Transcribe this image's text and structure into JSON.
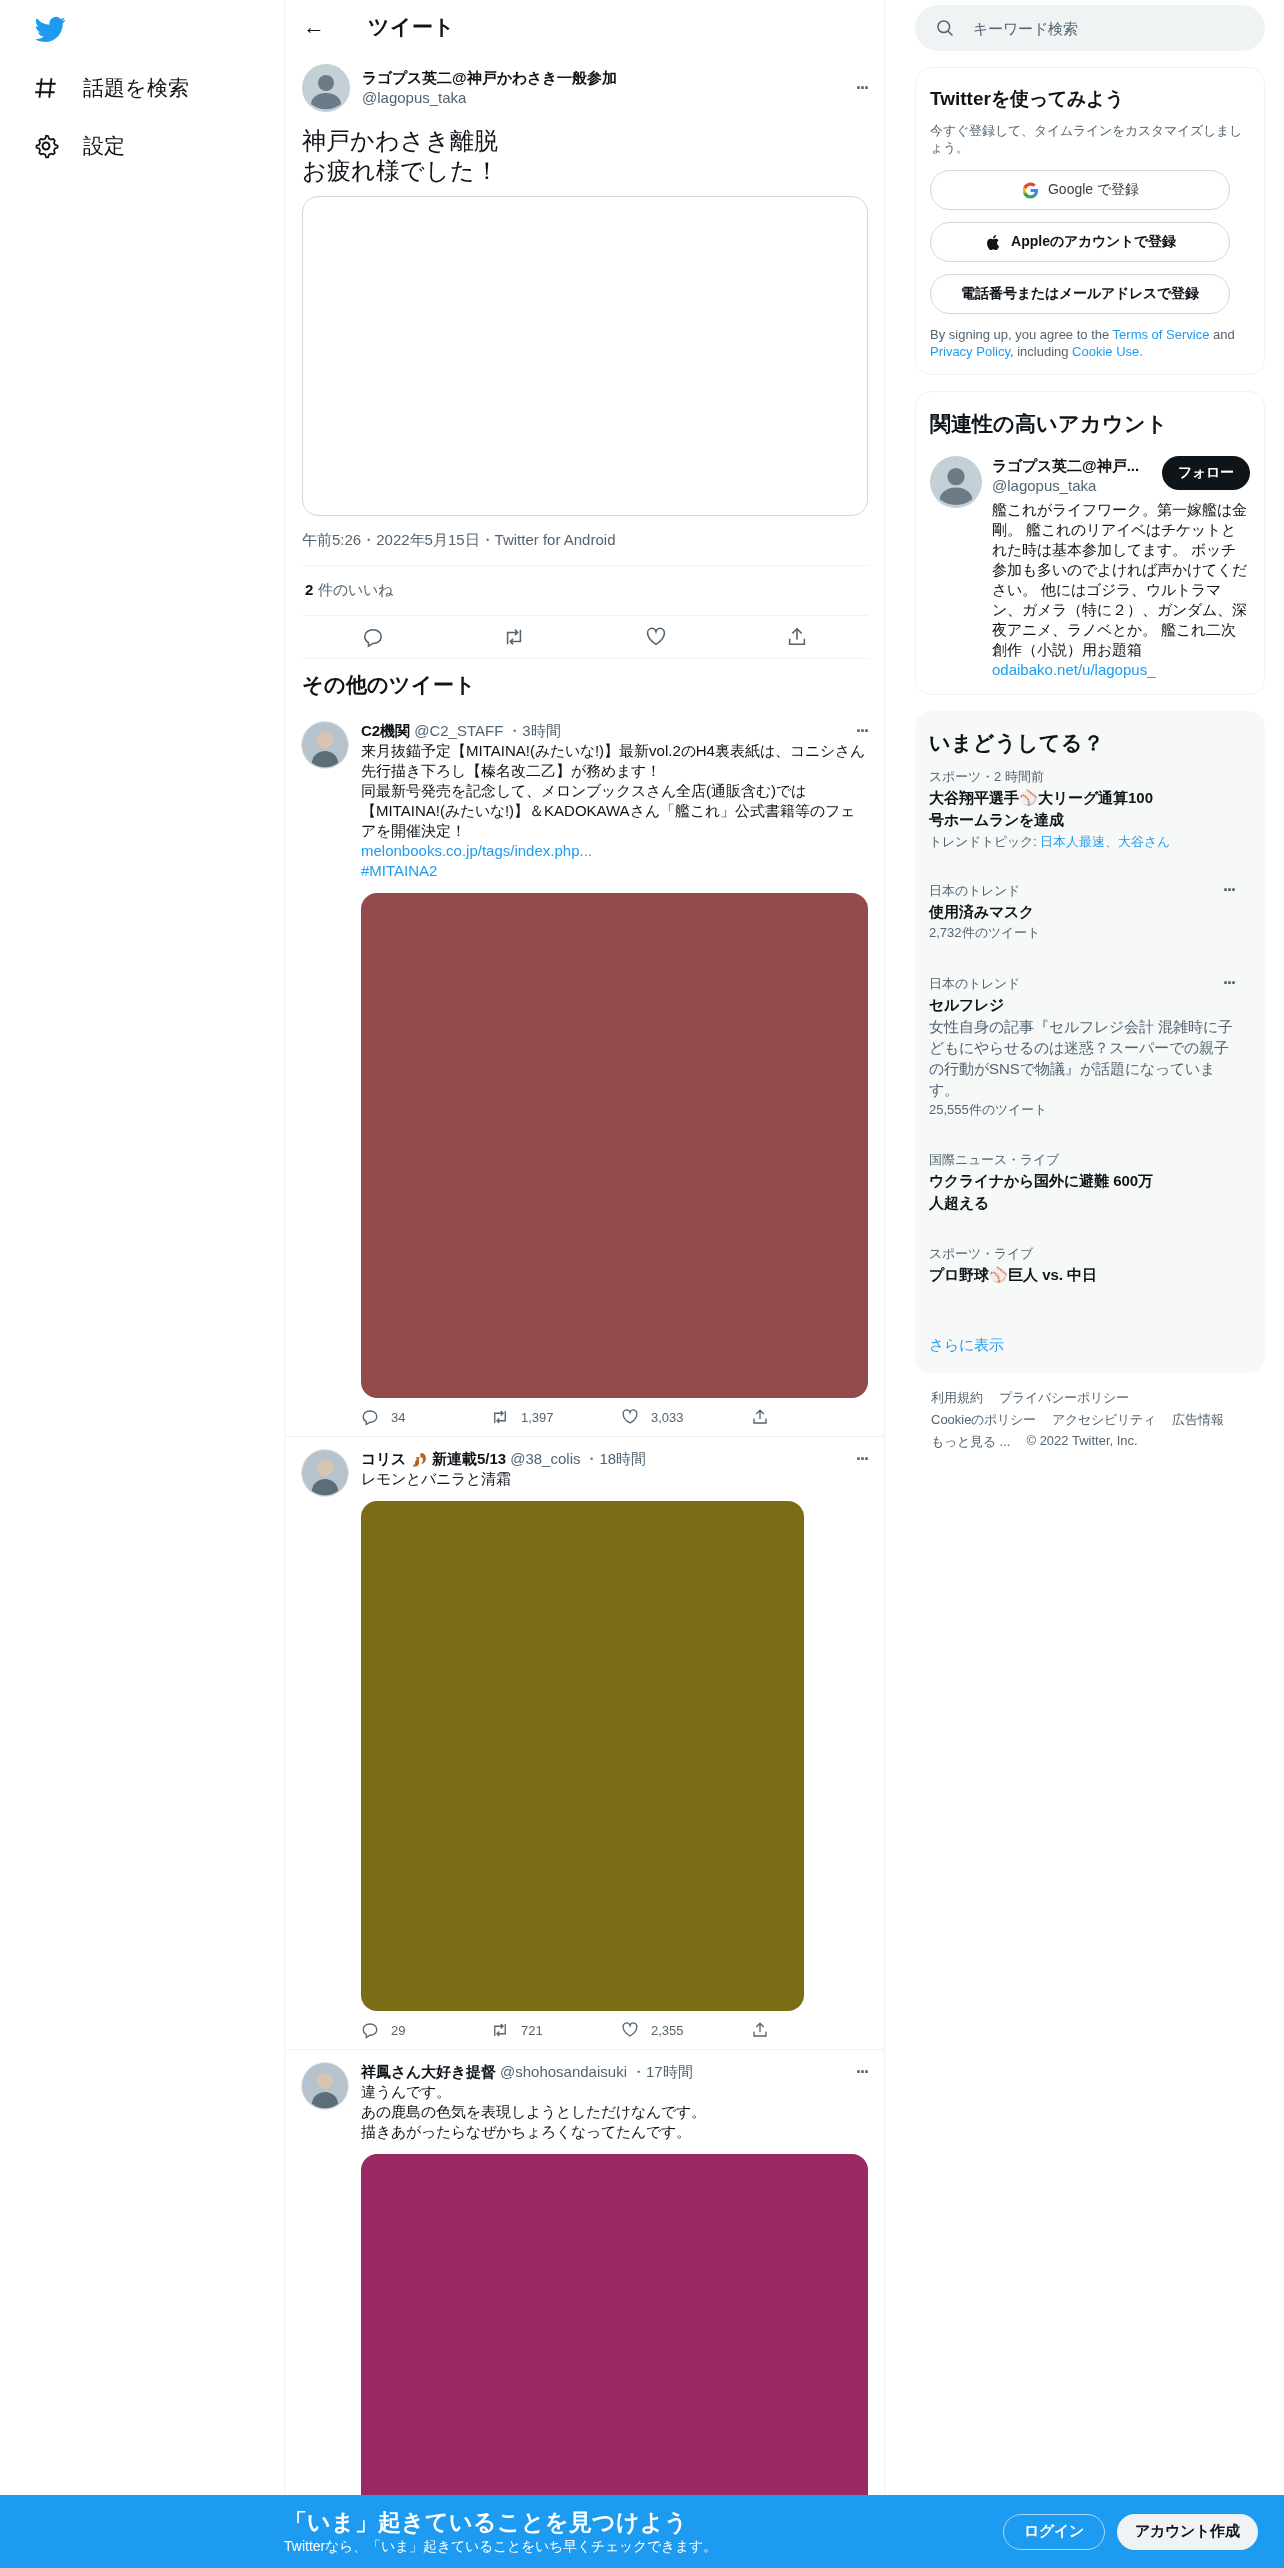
{
  "nav": {
    "items": [
      {
        "label": "話題を検索"
      },
      {
        "label": "設定"
      }
    ]
  },
  "header": {
    "back": "←",
    "title": "ツイート"
  },
  "main_tweet": {
    "name": "ラゴプス英二@神戸かわさき一般参加",
    "handle": "@lagopus_taka",
    "more": "···",
    "lines": [
      "神戸かわさき離脱",
      "お疲れ様でした！"
    ],
    "meta": "午前5:26・2022年5月15日・Twitter for Android",
    "likes_count": "2",
    "likes_label": "件のいいね"
  },
  "more_heading": "その他のツイート",
  "tweets": [
    {
      "name": "C2機関",
      "handle": "@C2_STAFF",
      "time": "・3時間",
      "more": "···",
      "lines": [
        "来月抜錨予定【MITAINA!(みたいな!)】最新vol.2のH4裏表紙は、コニシさん先行描き下ろし【榛名改二乙】が務めます！",
        "同最新号発売を記念して、メロンブックスさん全店(通販含む)では【MITAINA!(みたいな!)】＆KADOKAWAさん「艦これ」公式書籍等のフェアを開催決定！"
      ],
      "links": [
        "melonbooks.co.jp/tags/index.php...",
        "#MITAINA2"
      ],
      "media": {
        "color": "#934a4d",
        "wide": true
      },
      "replies": "34",
      "retweets": "1,397",
      "likes": "3,033"
    },
    {
      "name": "コリス",
      "squirrel": true,
      "name_suffix": "新連載5/13",
      "handle": "@38_colis",
      "time": "・18時間",
      "more": "···",
      "lines": [
        "レモンとバニラと清霜"
      ],
      "media": {
        "color": "#7b6d15",
        "wide": false
      },
      "replies": "29",
      "retweets": "721",
      "likes": "2,355"
    },
    {
      "name": "祥鳳さん大好き提督",
      "handle": "@shohosandaisuki",
      "time": "・17時間",
      "more": "···",
      "lines": [
        "違うんです。",
        "あの鹿島の色気を表現しようとしただけなんです。",
        "描きあがったらなぜかちょろくなってたんです。"
      ],
      "media": {
        "color": "#982963",
        "wide": true
      }
    }
  ],
  "search": {
    "placeholder": "キーワード検索"
  },
  "signup": {
    "title": "Twitterを使ってみよう",
    "subtitle": "今すぐ登録して、タイムラインをカスタマイズしましょう。",
    "buttons": [
      {
        "kind": "google",
        "label": "Google で登録"
      },
      {
        "kind": "apple",
        "label": "Appleのアカウントで登録"
      },
      {
        "kind": "plain",
        "label": "電話番号またはメールアドレスで登録"
      }
    ],
    "legal": [
      "By signing up, you agree to the ",
      "Terms of Service",
      " and ",
      "Privacy Policy",
      ", including ",
      "Cookie Use."
    ]
  },
  "related": {
    "title": "関連性の高いアカウント",
    "name": "ラゴプス英二@神戸...",
    "handle": "@lagopus_taka",
    "follow": "フォロー",
    "bio": "艦これがライフワーク。第一嫁艦は金剛。 艦これのリアイベはチケットとれた時は基本参加してます。 ボッチ参加も多いのでよければ声かけてください。 他にはゴジラ、ウルトラマン、ガメラ（特に２）、ガンダム、深夜アニメ、ラノベとか。 艦これ二次創作（小説）用お題箱",
    "bio_link": "odaibako.net/u/lagopus_"
  },
  "trends": {
    "title": "いまどうしてる？",
    "items": [
      {
        "context": "スポーツ・2 時間前",
        "title": "大谷翔平選手⚾大リーグ通算100号ホームランを達成",
        "topics_label": "トレンドトピック: ",
        "topics": "日本人最速、大谷さん"
      },
      {
        "context": "日本のトレンド",
        "title": "使用済みマスク",
        "count": "2,732件のツイート",
        "more": "···"
      },
      {
        "context": "日本のトレンド",
        "title": "セルフレジ",
        "desc": "女性自身の記事『セルフレジ会計 混雑時に子どもにやらせるのは迷惑？スーパーでの親子の行動がSNSで物議』が話題になっています。",
        "count": "25,555件のツイート",
        "more": "···"
      },
      {
        "context": "国際ニュース・ライブ",
        "title": "ウクライナから国外に避難 600万人超える"
      },
      {
        "context": "スポーツ・ライブ",
        "title": "プロ野球⚾巨人 vs. 中日"
      }
    ],
    "show_more": "さらに表示"
  },
  "footer": {
    "links": [
      "利用規約",
      "プライバシーポリシー",
      "Cookieのポリシー",
      "アクセシビリティ",
      "広告情報",
      "もっと見る ..."
    ],
    "copyright": "© 2022 Twitter, Inc."
  },
  "banner": {
    "title": "「いま」起きていることを見つけよう",
    "subtitle": "Twitterなら、「いま」起きていることをいち早くチェックできます。",
    "login": "ログイン",
    "signup": "アカウント作成"
  }
}
